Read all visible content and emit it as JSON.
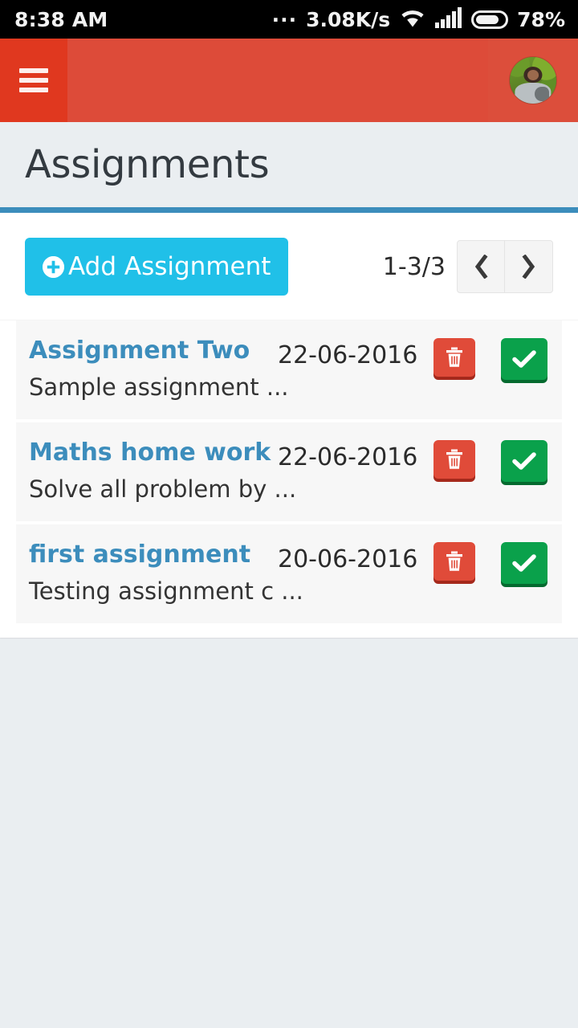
{
  "status_bar": {
    "time": "8:38 AM",
    "dots": "...",
    "network_speed": "3.08K/s",
    "wifi_icon": "wifi-icon",
    "signal_icon": "signal-bars-icon",
    "battery_icon": "battery-icon",
    "battery_percent": "78%"
  },
  "app_bar": {
    "menu_icon": "hamburger-menu-icon",
    "avatar_icon": "user-avatar"
  },
  "page": {
    "title": "Assignments"
  },
  "toolbar": {
    "add_label": "Add Assignment",
    "add_icon": "plus-circle-icon",
    "pager_count": "1-3/3",
    "prev_icon": "chevron-left-icon",
    "next_icon": "chevron-right-icon"
  },
  "list": {
    "rows": [
      {
        "title": "Assignment Two",
        "description": "Sample assignment ...",
        "date": "22-06-2016",
        "delete_icon": "trash-icon",
        "approve_icon": "check-icon"
      },
      {
        "title": "Maths home work",
        "description": "Solve all problem by ...",
        "date": "22-06-2016",
        "delete_icon": "trash-icon",
        "approve_icon": "check-icon"
      },
      {
        "title": "first assignment",
        "description": "Testing assignment c ...",
        "date": "20-06-2016",
        "delete_icon": "trash-icon",
        "approve_icon": "check-icon"
      }
    ]
  },
  "colors": {
    "app_bar": "#dd4b39",
    "accent_blue": "#3c8dbc",
    "add_button": "#20c0e8",
    "delete_button": "#e04b39",
    "approve_button": "#0aa14b",
    "background": "#eaeef1"
  }
}
